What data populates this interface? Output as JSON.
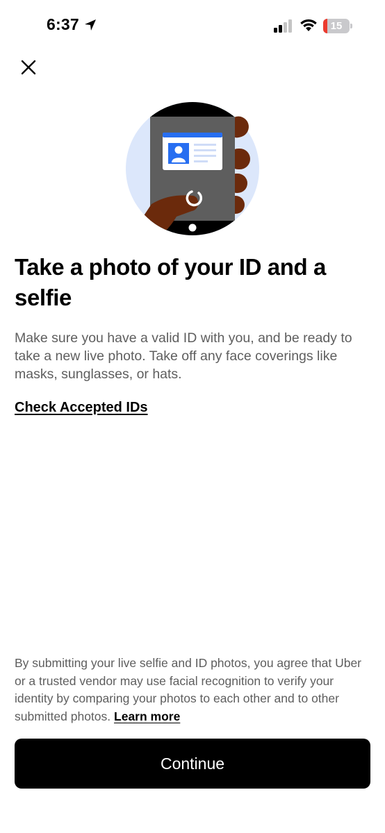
{
  "status_bar": {
    "time": "6:37",
    "battery_level": "15",
    "battery_color": "#eb3b2f"
  },
  "icons": {
    "close": "close-icon",
    "location": "location-arrow-icon",
    "signal": "cellular-signal-icon",
    "wifi": "wifi-icon"
  },
  "content": {
    "heading": "Take a photo of your ID and a selfie",
    "description": "Make sure you have a valid ID with you, and be ready to take a new live photo. Take off any face coverings like masks, sunglasses, or hats.",
    "accepted_ids_link": "Check Accepted IDs"
  },
  "footer": {
    "disclaimer": "By submitting your live selfie and ID photos, you agree that Uber or a trusted vendor may use facial recognition to verify your identity by comparing your photos to each other and to other submitted photos.",
    "learn_more": "Learn more",
    "continue_label": "Continue"
  },
  "colors": {
    "primary_button": "#000000",
    "illustration_circle": "#dce7fb",
    "id_card_header": "#276ef1",
    "skin": "#6b2a0c"
  }
}
